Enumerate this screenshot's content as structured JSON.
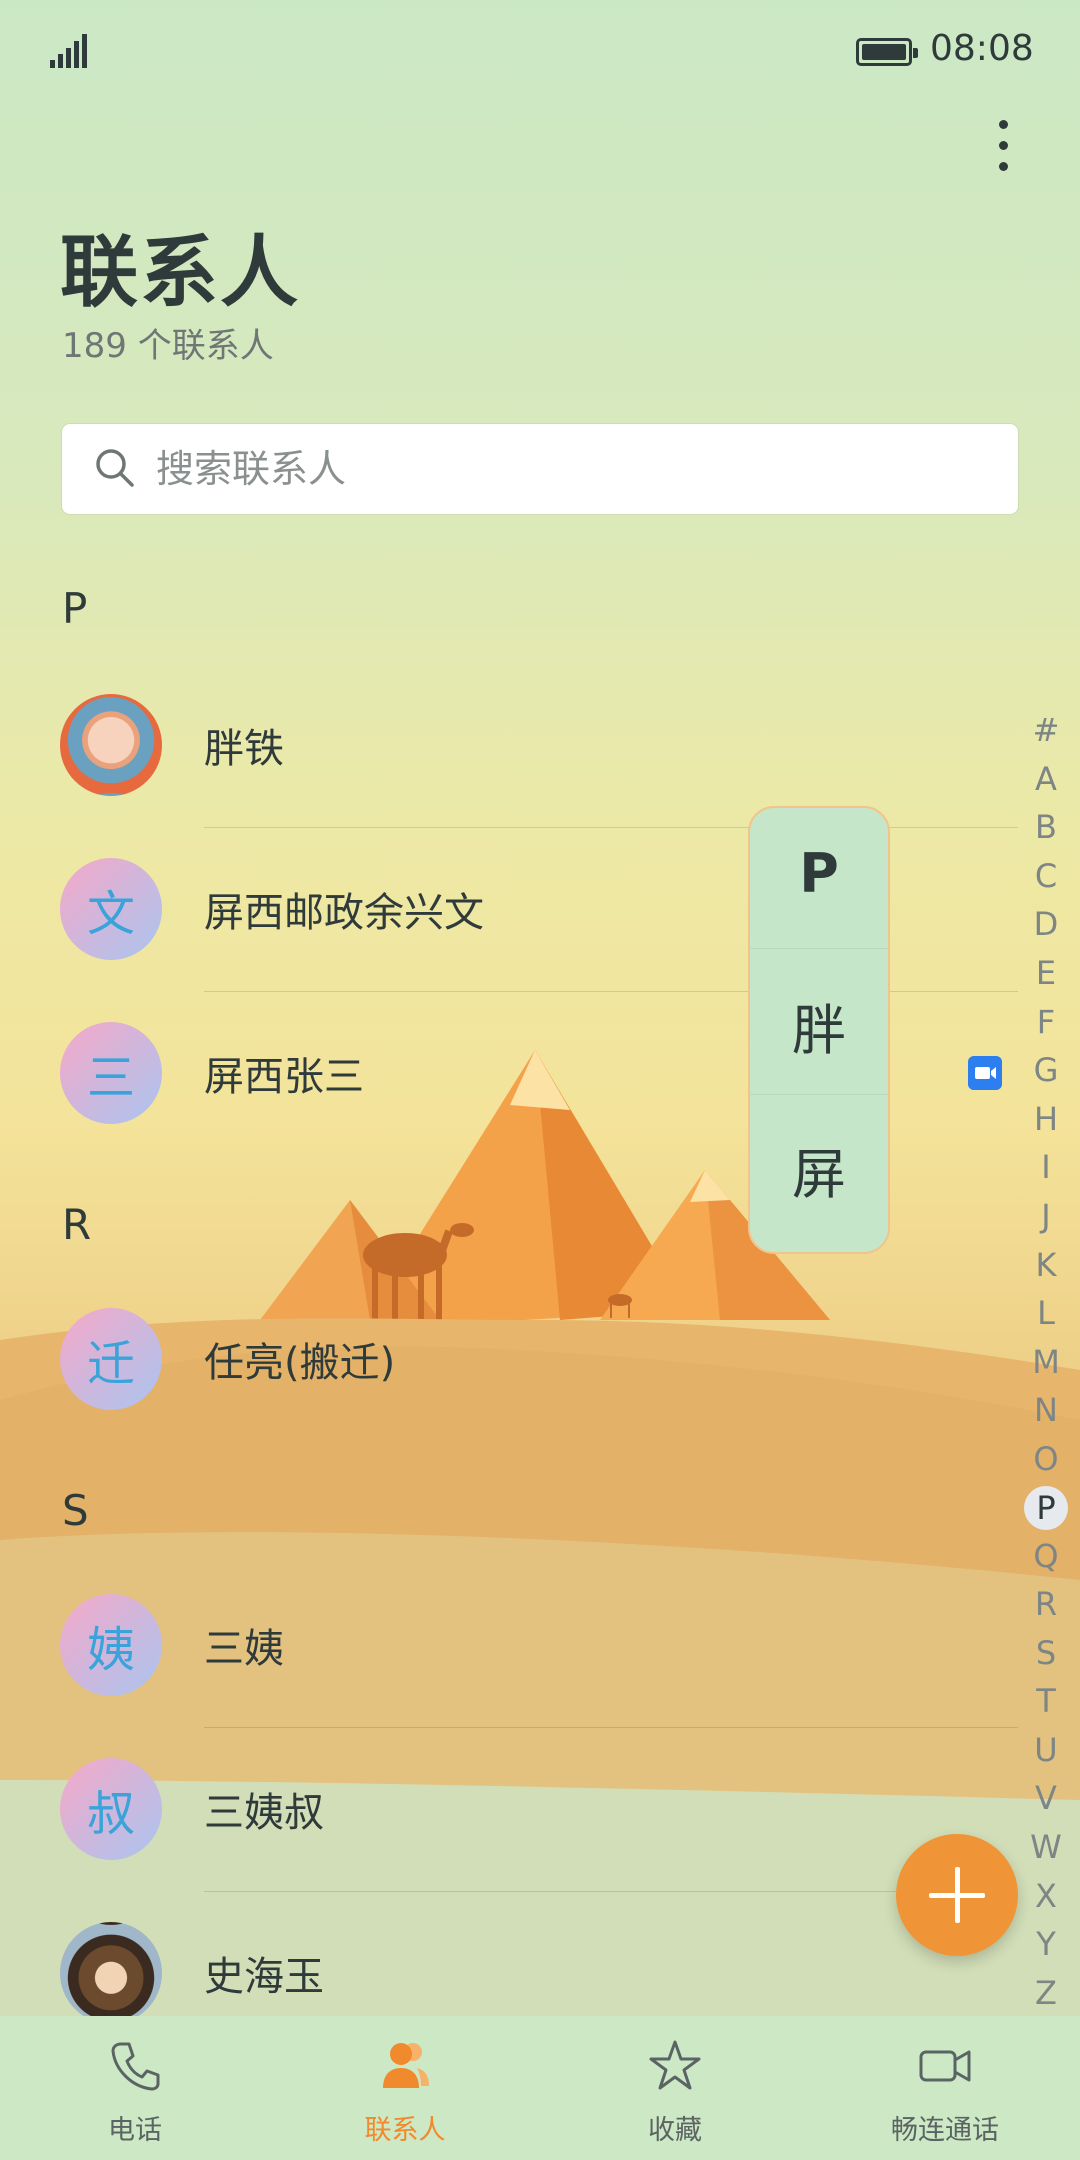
{
  "status_bar": {
    "time": "08:08"
  },
  "header": {
    "title": "联系人",
    "subtitle": "189 个联系人"
  },
  "search": {
    "placeholder": "搜索联系人"
  },
  "sections": [
    {
      "letter": "P",
      "contacts": [
        {
          "name": "胖铁",
          "avatar_type": "photo"
        },
        {
          "name": "屏西邮政余兴文",
          "avatar_letter": "文"
        },
        {
          "name": "屏西张三",
          "avatar_letter": "三",
          "badge": "video-call-icon"
        }
      ]
    },
    {
      "letter": "R",
      "contacts": [
        {
          "name": "任亮(搬迁)",
          "avatar_letter": "迁"
        }
      ]
    },
    {
      "letter": "S",
      "contacts": [
        {
          "name": "三姨",
          "avatar_letter": "姨"
        },
        {
          "name": "三姨叔",
          "avatar_letter": "叔"
        },
        {
          "name": "史海玉",
          "avatar_type": "photo"
        }
      ]
    }
  ],
  "letter_popup": {
    "letter": "P",
    "items": [
      "胖",
      "屏"
    ]
  },
  "alpha_index": [
    "#",
    "A",
    "B",
    "C",
    "D",
    "E",
    "F",
    "G",
    "H",
    "I",
    "J",
    "K",
    "L",
    "M",
    "N",
    "O",
    "P",
    "Q",
    "R",
    "S",
    "T",
    "U",
    "V",
    "W",
    "X",
    "Y",
    "Z"
  ],
  "alpha_index_active": "P",
  "bottom_nav": [
    {
      "label": "电话",
      "icon": "phone-icon",
      "active": false
    },
    {
      "label": "联系人",
      "icon": "contacts-icon",
      "active": true
    },
    {
      "label": "收藏",
      "icon": "star-icon",
      "active": false
    },
    {
      "label": "畅连通话",
      "icon": "video-call-icon",
      "active": false
    }
  ],
  "colors": {
    "accent": "#f08a2c",
    "fab": "#f09537",
    "avatar_letter": "#3aa3d9",
    "badge": "#2d7ff0"
  }
}
